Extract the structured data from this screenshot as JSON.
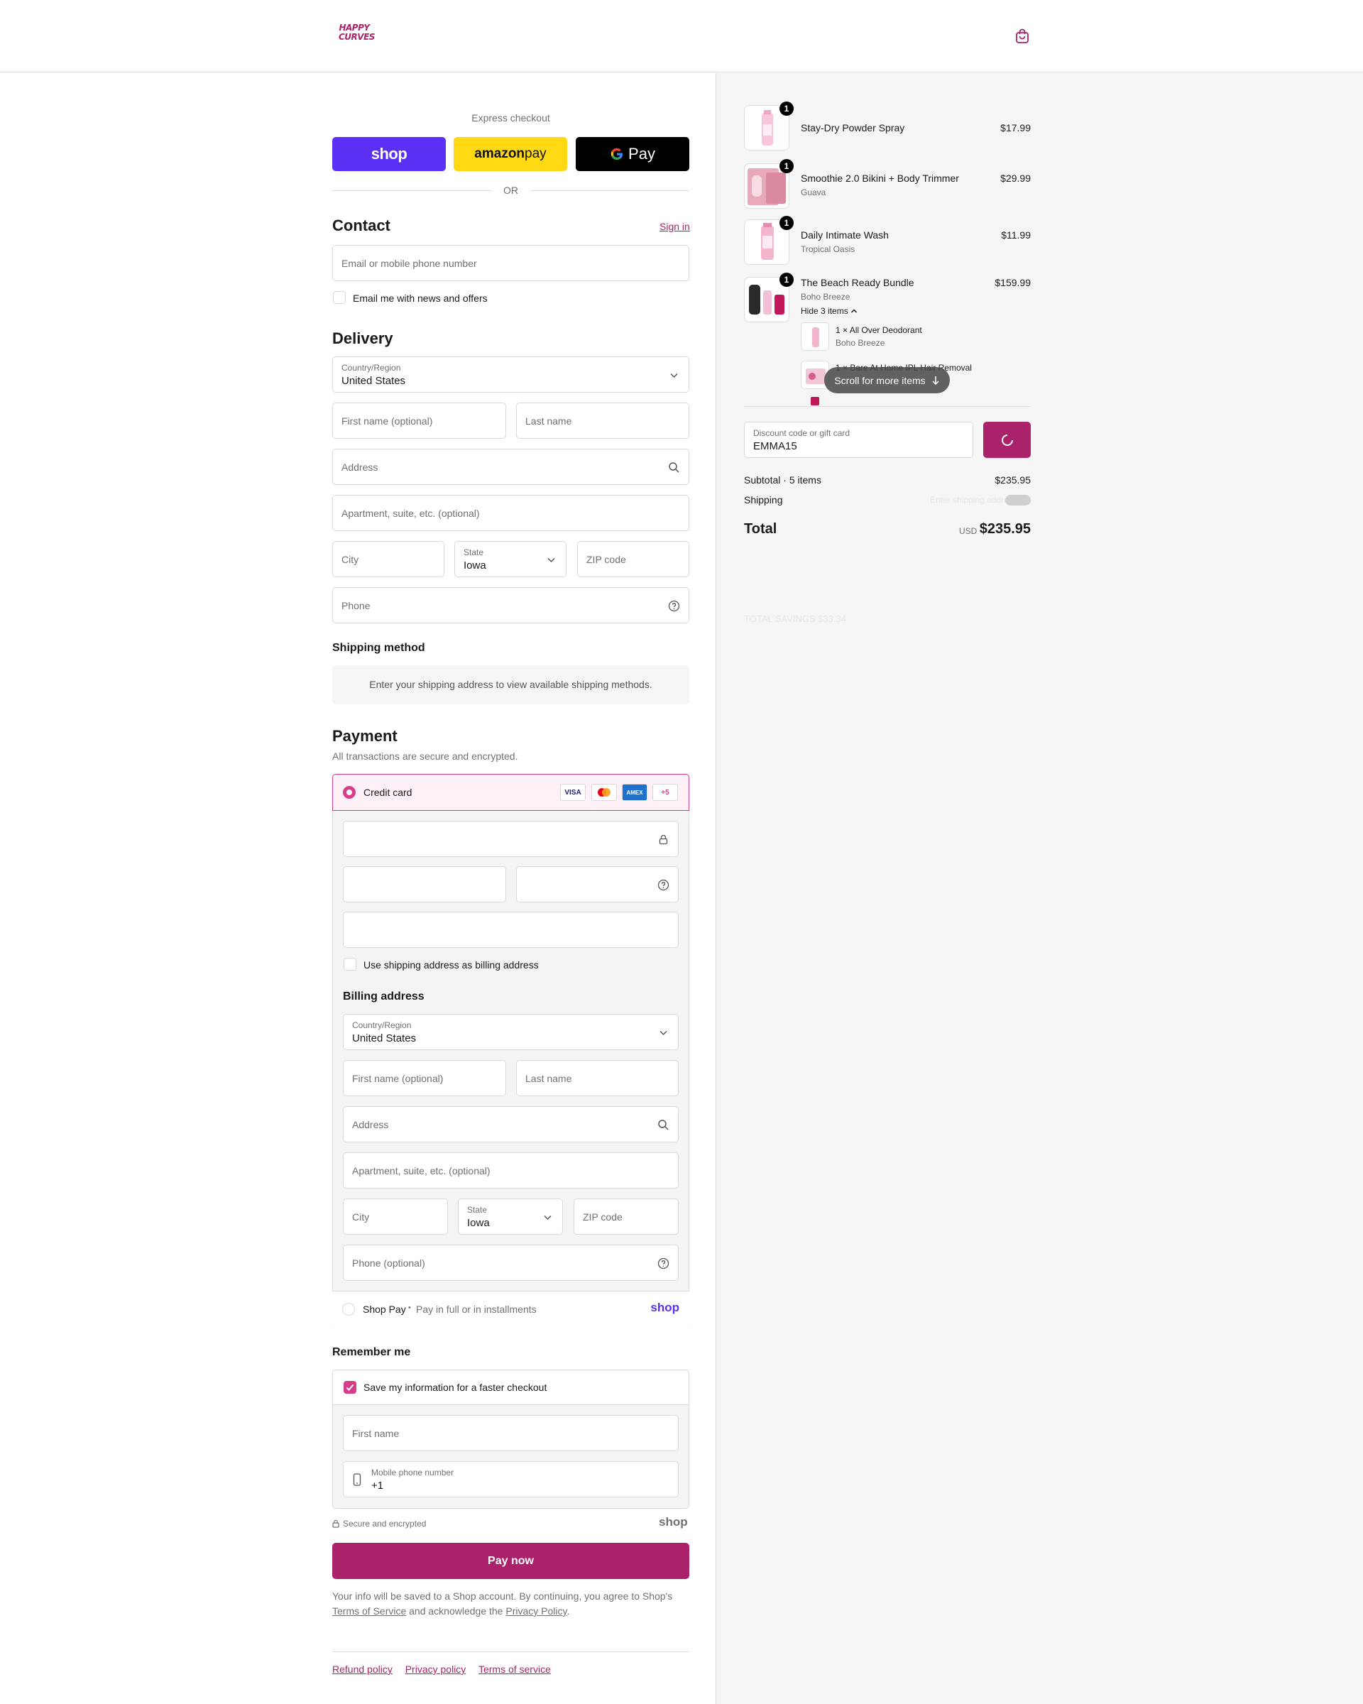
{
  "brand": {
    "logo_text": "HAPPY CURVES",
    "accent": "#a9226a",
    "pink": "#d63d8d"
  },
  "express": {
    "title": "Express checkout",
    "shop_label": "shop",
    "amazon_label_a": "amazon",
    "amazon_label_b": " pay",
    "gpay_label": "Pay",
    "or": "OR"
  },
  "contact": {
    "title": "Contact",
    "sign_in": "Sign in",
    "email_placeholder": "Email or mobile phone number",
    "news_label": "Email me with news and offers"
  },
  "delivery": {
    "title": "Delivery",
    "country_label": "Country/Region",
    "country_value": "United States",
    "first_name_ph": "First name (optional)",
    "last_name_ph": "Last name",
    "address_ph": "Address",
    "apt_ph": "Apartment, suite, etc. (optional)",
    "city_ph": "City",
    "state_label": "State",
    "state_value": "Iowa",
    "zip_ph": "ZIP code",
    "phone_ph": "Phone"
  },
  "shipping_method": {
    "title": "Shipping method",
    "note": "Enter your shipping address to view available shipping methods."
  },
  "payment": {
    "title": "Payment",
    "subtitle": "All transactions are secure and encrypted.",
    "credit_card_label": "Credit card",
    "card_badges": [
      "VISA",
      "MC",
      "AMEX",
      "+5"
    ],
    "use_shipping_label": "Use shipping address as billing address",
    "billing_title": "Billing address",
    "billing_country_label": "Country/Region",
    "billing_country_value": "United States",
    "billing_first_ph": "First name (optional)",
    "billing_last_ph": "Last name",
    "billing_address_ph": "Address",
    "billing_apt_ph": "Apartment, suite, etc. (optional)",
    "billing_city_ph": "City",
    "billing_state_label": "State",
    "billing_state_value": "Iowa",
    "billing_zip_ph": "ZIP code",
    "billing_phone_ph": "Phone (optional)",
    "shoppay_label": "Shop Pay",
    "shoppay_sep": "•",
    "shoppay_desc": "Pay in full or in installments",
    "shoppay_logo": "shop"
  },
  "remember": {
    "title": "Remember me",
    "save_label": "Save my information for a faster checkout",
    "first_name_ph": "First name",
    "mobile_label": "Mobile phone number",
    "mobile_value": "+1",
    "secure_label": "Secure and encrypted",
    "shop_logo": "shop"
  },
  "pay_now": "Pay now",
  "legal": {
    "text1": "Your info will be saved to a Shop account. By continuing, you agree to Shop's",
    "tos": "Terms of Service",
    "text2": " and acknowledge the ",
    "privacy": "Privacy Policy",
    "text3": "."
  },
  "footer": {
    "refund": "Refund policy",
    "privacy": "Privacy policy",
    "terms": "Terms of service"
  },
  "summary": {
    "items": [
      {
        "name": "Stay-Dry Powder Spray",
        "variant": "",
        "price": "$17.99",
        "qty": "1"
      },
      {
        "name": "Smoothie 2.0 Bikini + Body Trimmer",
        "variant": "Guava",
        "price": "$29.99",
        "qty": "1"
      },
      {
        "name": "Daily Intimate Wash",
        "variant": "Tropical Oasis",
        "price": "$11.99",
        "qty": "1"
      },
      {
        "name": "The Beach Ready Bundle",
        "variant": "Boho Breeze",
        "price": "$159.99",
        "qty": "1"
      }
    ],
    "bundle_toggle": "Hide 3 items",
    "sub_items": [
      {
        "name": "1 × All Over Deodorant",
        "variant": "Boho Breeze"
      },
      {
        "name": "1 × Bare At Home IPL Hair Removal",
        "variant": ""
      }
    ],
    "scroll_hint": "Scroll for more items",
    "discount_label": "Discount code or gift card",
    "discount_value": "EMMA15",
    "subtotal_label": "Subtotal · 5 items",
    "subtotal_value": "$235.95",
    "shipping_label": "Shipping",
    "shipping_value": "Enter shipping address",
    "total_label": "Total",
    "total_currency": "USD",
    "total_value": "$235.95",
    "ghost_savings": "TOTAL SAVINGS $33.34"
  }
}
